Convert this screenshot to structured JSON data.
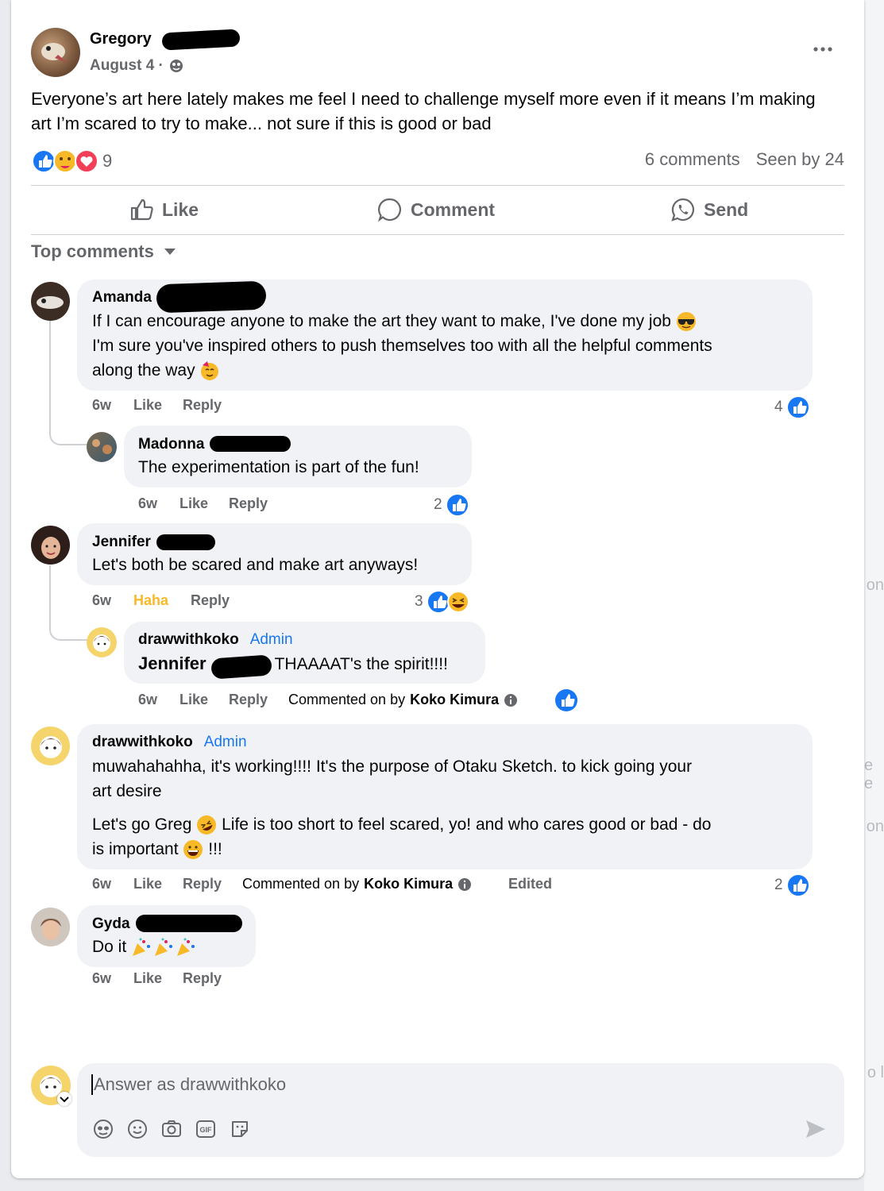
{
  "colors": {
    "brand_blue": "#1877f2",
    "haha_yellow": "#f7b928",
    "bubble_bg": "#f0f2f5",
    "text_secondary": "#65676b"
  },
  "post": {
    "author": "Gregory",
    "date": "August 4 ·",
    "privacy_icon": "globe-icon",
    "text": "Everyone’s art here lately makes me feel I need to challenge myself more even if it means I’m making art I’m scared to try to make... not sure if this is good or bad",
    "reactions": {
      "icons": [
        "like",
        "care",
        "love"
      ],
      "count": "9"
    },
    "comments_count": "6 comments",
    "seen_by": "Seen by 24"
  },
  "actions": {
    "like": "Like",
    "comment": "Comment",
    "send": "Send"
  },
  "comments_filter": "Top comments",
  "comments": [
    {
      "author": "Amanda",
      "text_line1": "If I can encourage anyone to make the art they want to make, I've done my job",
      "text_line2": "I'm sure you've inspired others to push themselves too with all the helpful comments",
      "text_line3": "along the way",
      "time": "6w",
      "like": "Like",
      "reply": "Reply",
      "reaction_count": "4",
      "replies": [
        {
          "author": "Madonna",
          "text": "The experimentation is part of the fun!",
          "time": "6w",
          "like": "Like",
          "reply": "Reply",
          "reaction_count": "2"
        }
      ]
    },
    {
      "author": "Jennifer",
      "text": "Let's both be scared and make art anyways!",
      "time": "6w",
      "like": "Haha",
      "reply": "Reply",
      "reaction_count": "3",
      "replies": [
        {
          "author": "drawwithkoko",
          "badge": "Admin",
          "mention": "Jennifer",
          "text": "THAAAAT's the spirit!!!!",
          "time": "6w",
          "like": "Like",
          "reply": "Reply",
          "commented_on_by_prefix": "Commented on by",
          "commented_on_by_name": "Koko Kimura"
        }
      ]
    },
    {
      "author": "drawwithkoko",
      "badge": "Admin",
      "text_p1_line1": "muwahahahha, it's working!!!! It's the purpose of Otaku Sketch. to kick going your",
      "text_p1_line2": "art desire",
      "text_p2_line1_a": "Let's go Greg",
      "text_p2_line1_b": "Life is too short to feel scared, yo! and who cares good or bad - do",
      "text_p2_line2_a": "is important",
      "text_p2_line2_b": "!!!",
      "time": "6w",
      "like": "Like",
      "reply": "Reply",
      "commented_on_by_prefix": "Commented on by",
      "commented_on_by_name": "Koko Kimura",
      "edited": "Edited",
      "reaction_count": "2"
    },
    {
      "author": "Gyda",
      "text": "Do it",
      "time": "6w",
      "like": "Like",
      "reply": "Reply"
    }
  ],
  "composer": {
    "placeholder": "Answer as drawwithkoko",
    "tools": [
      "avatar-sticker-icon",
      "emoji-icon",
      "camera-icon",
      "gif-icon",
      "sticker-icon"
    ]
  },
  "background_fragments": [
    "on",
    "e e",
    "on",
    "o l"
  ]
}
